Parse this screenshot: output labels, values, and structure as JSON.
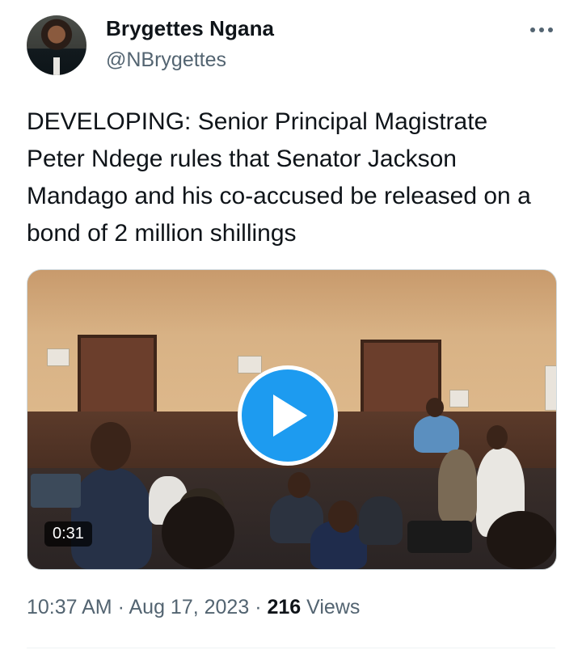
{
  "author": {
    "name": "Brygettes Ngana",
    "handle": "@NBrygettes"
  },
  "tweet": {
    "text": "DEVELOPING: Senior Principal Magistrate Peter Ndege rules that Senator Jackson Mandago and his co-accused be released on a bond of 2 million shillings"
  },
  "media": {
    "type": "video",
    "duration": "0:31",
    "play_icon": "play-icon"
  },
  "meta": {
    "time": "10:37 AM",
    "separator": "·",
    "date": "Aug 17, 2023",
    "views_count": "216",
    "views_label": "Views"
  },
  "icons": {
    "more": "more-icon"
  },
  "colors": {
    "accent": "#1d9bf0",
    "text": "#0f1419",
    "secondary": "#536471"
  }
}
